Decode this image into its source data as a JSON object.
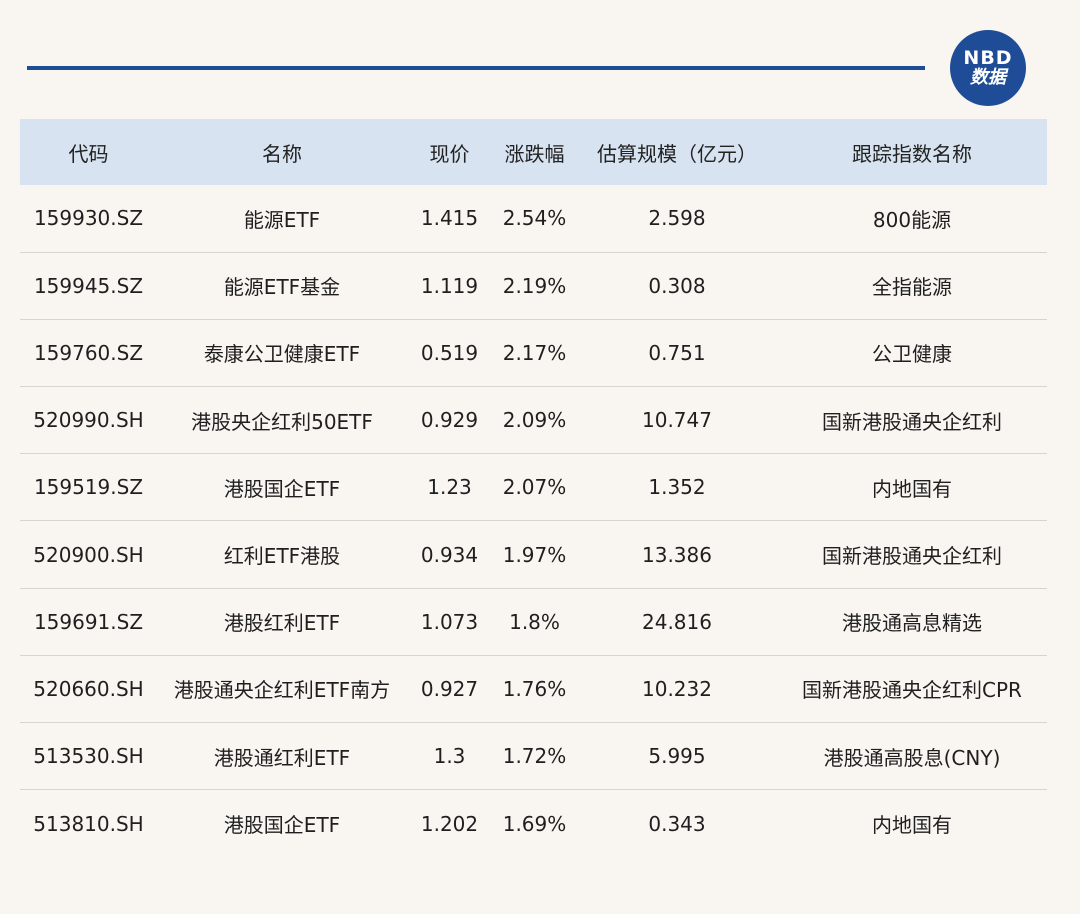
{
  "logo": {
    "line1": "NBD",
    "line2": "数据"
  },
  "table": {
    "headers": [
      "代码",
      "名称",
      "现价",
      "涨跌幅",
      "估算规模（亿元）",
      "跟踪指数名称"
    ],
    "rows": [
      [
        "159930.SZ",
        "能源ETF",
        "1.415",
        "2.54%",
        "2.598",
        "800能源"
      ],
      [
        "159945.SZ",
        "能源ETF基金",
        "1.119",
        "2.19%",
        "0.308",
        "全指能源"
      ],
      [
        "159760.SZ",
        "泰康公卫健康ETF",
        "0.519",
        "2.17%",
        "0.751",
        "公卫健康"
      ],
      [
        "520990.SH",
        "港股央企红利50ETF",
        "0.929",
        "2.09%",
        "10.747",
        "国新港股通央企红利"
      ],
      [
        "159519.SZ",
        "港股国企ETF",
        "1.23",
        "2.07%",
        "1.352",
        "内地国有"
      ],
      [
        "520900.SH",
        "红利ETF港股",
        "0.934",
        "1.97%",
        "13.386",
        "国新港股通央企红利"
      ],
      [
        "159691.SZ",
        "港股红利ETF",
        "1.073",
        "1.8%",
        "24.816",
        "港股通高息精选"
      ],
      [
        "520660.SH",
        "港股通央企红利ETF南方",
        "0.927",
        "1.76%",
        "10.232",
        "国新港股通央企红利CPR"
      ],
      [
        "513530.SH",
        "港股通红利ETF",
        "1.3",
        "1.72%",
        "5.995",
        "港股通高股息(CNY)"
      ],
      [
        "513810.SH",
        "港股国企ETF",
        "1.202",
        "1.69%",
        "0.343",
        "内地国有"
      ]
    ]
  },
  "colors": {
    "accent": "#1f4c96",
    "header_bg": "#d8e3f1",
    "page_bg": "#f9f6f2"
  }
}
